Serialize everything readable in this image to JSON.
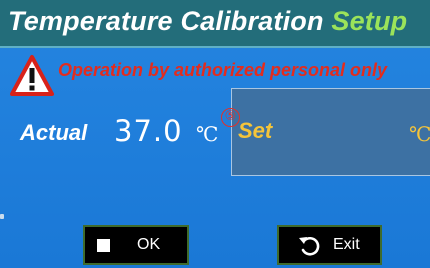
{
  "title": {
    "main": "Temperature  Calibration",
    "accent": "Setup"
  },
  "warning": {
    "text": "Operation by authorized personal only",
    "icon": "warning-triangle-icon"
  },
  "actual": {
    "label": "Actual",
    "value": "37.0",
    "unit": "℃"
  },
  "callout": {
    "marker": "⑤"
  },
  "set": {
    "label": "Set",
    "value": "",
    "unit": "℃"
  },
  "buttons": {
    "ok": {
      "label": "OK",
      "icon": "stop-square-icon"
    },
    "exit": {
      "label": "Exit",
      "icon": "undo-arrow-icon"
    }
  },
  "colors": {
    "background": "#1f7bd9",
    "title_bar": "#236d7a",
    "title_accent": "#9be35a",
    "warning_text": "#e32c1e",
    "set_text": "#f4c43a",
    "set_panel": "#3d71a3",
    "button_bg": "#000000",
    "button_border": "#3f6b2c"
  }
}
